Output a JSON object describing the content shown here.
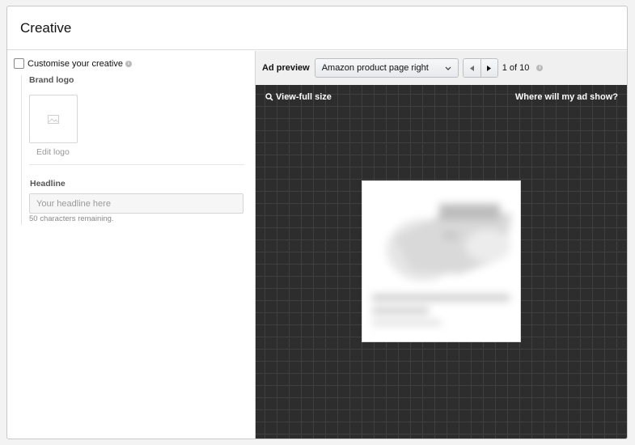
{
  "header": {
    "title": "Creative"
  },
  "customise": {
    "label": "Customise your creative",
    "checked": false,
    "info_icon": "info-icon"
  },
  "brand_logo": {
    "label": "Brand logo",
    "edit_label": "Edit logo",
    "placeholder_icon": "image-placeholder-icon"
  },
  "headline": {
    "label": "Headline",
    "placeholder": "Your headline here",
    "value": "",
    "chars_remaining": "50 characters remaining."
  },
  "preview": {
    "label": "Ad preview",
    "placement": "Amazon product page right",
    "page_count": "1 of 10",
    "view_full_size": "View-full size",
    "where_will_ad_show": "Where will my ad show?",
    "background_color": "#2d2d2d"
  }
}
